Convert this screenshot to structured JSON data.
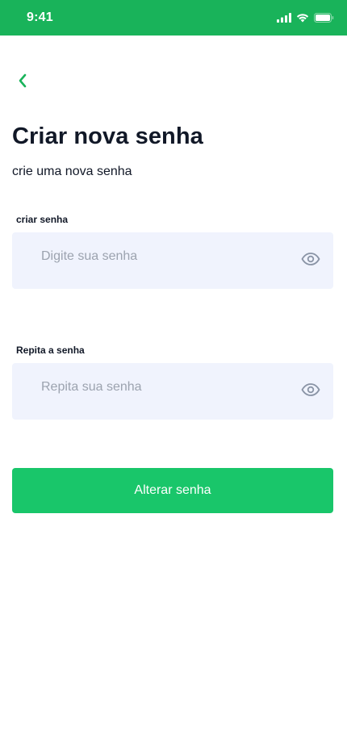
{
  "status_bar": {
    "time": "9:41",
    "icons": [
      "cellular-signal-icon",
      "wifi-icon",
      "battery-icon"
    ],
    "background_color": "#19B35A"
  },
  "header": {
    "back_icon": "chevron-left-icon",
    "accent_color": "#19B35A"
  },
  "page": {
    "title": "Criar nova senha",
    "subtitle": "crie uma nova senha"
  },
  "form": {
    "password": {
      "label": "criar senha",
      "placeholder": "Digite sua senha",
      "value": "",
      "toggle_icon": "eye-icon"
    },
    "confirm_password": {
      "label": "Repita a senha",
      "placeholder": "Repita sua senha",
      "value": "",
      "toggle_icon": "eye-icon"
    },
    "field_background": "#F0F3FD",
    "submit_label": "Alterar senha",
    "submit_color": "#19C66A"
  }
}
